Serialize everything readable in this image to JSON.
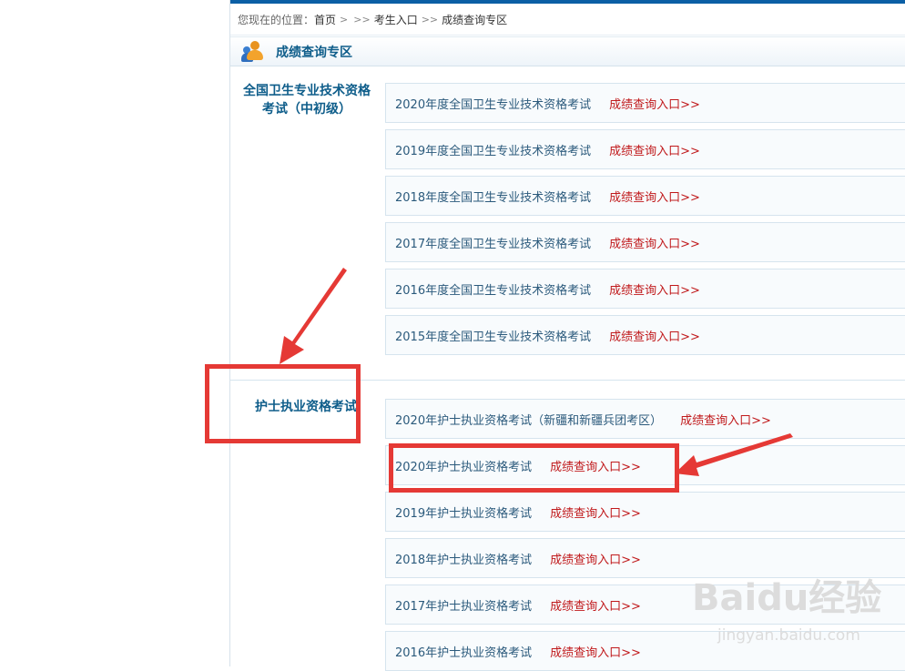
{
  "breadcrumb": {
    "prefix": "您现在的位置：",
    "items": [
      "首页",
      "考生入口",
      "成绩查询专区"
    ],
    "separator": ">"
  },
  "section": {
    "title": "成绩查询专区",
    "icon": "users-icon"
  },
  "groups": [
    {
      "label": "全国卫生专业技术资格考试（中初级）",
      "label_line1": "全国卫生专业技术资格",
      "label_line2": "考试（中初级）",
      "rows": [
        {
          "name": "2020年度全国卫生专业技术资格考试",
          "entry": "成绩查询入口>>"
        },
        {
          "name": "2019年度全国卫生专业技术资格考试",
          "entry": "成绩查询入口>>"
        },
        {
          "name": "2018年度全国卫生专业技术资格考试",
          "entry": "成绩查询入口>>"
        },
        {
          "name": "2017年度全国卫生专业技术资格考试",
          "entry": "成绩查询入口>>"
        },
        {
          "name": "2016年度全国卫生专业技术资格考试",
          "entry": "成绩查询入口>>"
        },
        {
          "name": "2015年度全国卫生专业技术资格考试",
          "entry": "成绩查询入口>>"
        }
      ]
    },
    {
      "label": "护士执业资格考试",
      "rows": [
        {
          "name": "2020年护士执业资格考试（新疆和新疆兵团考区）",
          "entry": "成绩查询入口>>"
        },
        {
          "name": "2020年护士执业资格考试",
          "entry": "成绩查询入口>>"
        },
        {
          "name": "2019年护士执业资格考试",
          "entry": "成绩查询入口>>"
        },
        {
          "name": "2018年护士执业资格考试",
          "entry": "成绩查询入口>>"
        },
        {
          "name": "2017年护士执业资格考试",
          "entry": "成绩查询入口>>"
        },
        {
          "name": "2016年护士执业资格考试",
          "entry": "成绩查询入口>>"
        }
      ]
    }
  ],
  "watermark": {
    "text": "Baidu经验",
    "sub": "jingyan.baidu.com"
  },
  "colors": {
    "accent": "#0e5d8a",
    "link_red": "#c0191b",
    "annotation_red": "#e53935",
    "top_bar": "#0b5fa5"
  }
}
